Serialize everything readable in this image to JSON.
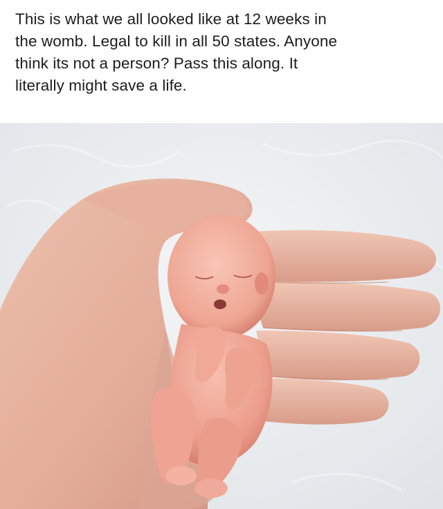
{
  "post": {
    "caption": "This is what we all looked like at 12 weeks in\nthe womb. Legal to kill in all 50 states.  Anyone\nthink its not a person?  Pass this along.  It\nliterally might save a life."
  },
  "photo": {
    "subjects": [
      "open-hand",
      "fetus-model",
      "white-blanket-background"
    ],
    "colors": {
      "background": "#e9ecef",
      "skin": "#e8b39f",
      "skin_shadow": "#c98a78",
      "fetus": "#f0a595",
      "fetus_shadow": "#d9786a"
    }
  }
}
